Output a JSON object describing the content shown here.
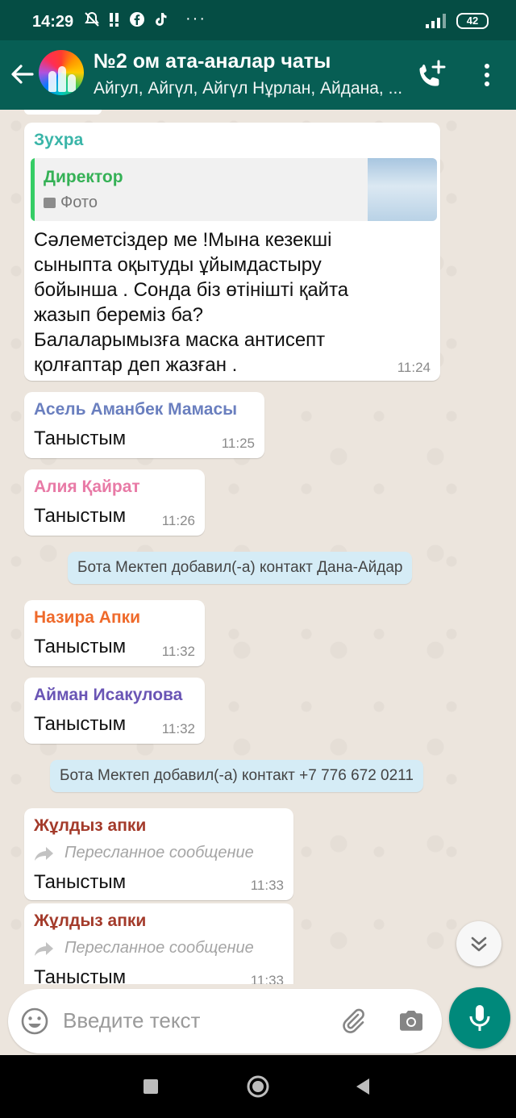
{
  "status_bar": {
    "time": "14:29",
    "battery": "42",
    "dots": "···"
  },
  "header": {
    "title": "№2 ом ата-аналар чаты",
    "subtitle": "Айгул, Айгүл, Айгүл Нұрлан, Айдана, ...",
    "colors": {
      "header_bg": "#075e54",
      "status_bg": "#054d44"
    }
  },
  "messages": [
    {
      "sender": "Зухра",
      "sender_color": "#3ab5a8",
      "reply": {
        "name": "Директор",
        "type": "Фото"
      },
      "text_lines": [
        "Сәлеметсіздер ме !Мына кезекші",
        "сыныпта оқытуды ұйымдастыру",
        "бойынша . Сонда біз өтінішті қайта",
        "жазып береміз ба?",
        "Балаларымызға маска антисепт",
        "қолғаптар деп жазған ."
      ],
      "time": "11:24"
    },
    {
      "sender": "Асель Аманбек Мамасы",
      "sender_color": "#6a7fbf",
      "text": "Таныстым",
      "time": "11:25"
    },
    {
      "sender": "Алия Қайрат",
      "sender_color": "#e87aa6",
      "text": "Таныстым",
      "time": "11:26"
    },
    {
      "sender": "Назира Апки",
      "sender_color": "#ef6a2b",
      "text": "Таныстым",
      "time": "11:32"
    },
    {
      "sender": "Айман Исакулова",
      "sender_color": "#6a55b5",
      "text": "Таныстым",
      "time": "11:32"
    },
    {
      "sender": "Жұлдыз апки",
      "sender_color": "#a33a2a",
      "forwarded": "Пересланное сообщение",
      "text": "Таныстым",
      "time": "11:33"
    },
    {
      "sender": "Жұлдыз апки",
      "sender_color": "#a33a2a",
      "forwarded": "Пересланное сообщение",
      "text": "Таныстым",
      "time": "11:33"
    }
  ],
  "system_messages": [
    "Бота Мектеп добавил(-а) контакт Дана-Айдар",
    "Бота Мектеп добавил(-а) контакт +7 776 672 0211"
  ],
  "input": {
    "placeholder": "Введите текст"
  },
  "icons": {
    "back": "arrow-left-icon",
    "call": "add-call-icon",
    "menu": "more-vert-icon",
    "emoji": "emoji-icon",
    "attach": "paperclip-icon",
    "camera": "camera-icon",
    "mic": "mic-icon",
    "scroll": "double-chevron-down-icon"
  },
  "colors": {
    "accent": "#00897b",
    "chat_bg": "#ece5dd",
    "system_bg": "#d5ecf6"
  }
}
